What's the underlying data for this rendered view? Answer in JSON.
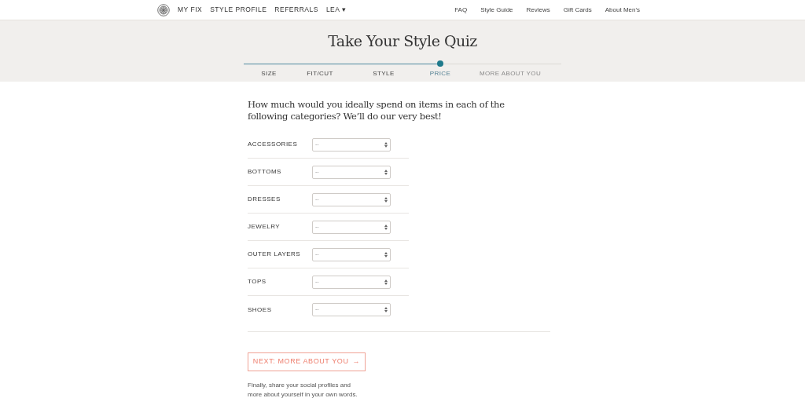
{
  "nav": {
    "left": [
      "MY FIX",
      "STYLE PROFILE",
      "REFERRALS"
    ],
    "user": "LEA",
    "user_caret": "▾",
    "right": [
      "FAQ",
      "Style Guide",
      "Reviews",
      "Gift Cards",
      "About Men's"
    ]
  },
  "title": "Take Your Style Quiz",
  "steps": [
    {
      "label": "SIZE",
      "selected": false
    },
    {
      "label": "FIT/CUT",
      "selected": false
    },
    {
      "label": "STYLE",
      "selected": false
    },
    {
      "label": "PRICE",
      "selected": true
    },
    {
      "label": "MORE ABOUT YOU",
      "selected": false
    }
  ],
  "question": "How much would you ideally spend on items in each of the following categories? We’ll do our very best!",
  "categories": [
    {
      "label": "ACCESSORIES",
      "value": "--"
    },
    {
      "label": "BOTTOMS",
      "value": "--"
    },
    {
      "label": "DRESSES",
      "value": "--"
    },
    {
      "label": "JEWELRY",
      "value": "--"
    },
    {
      "label": "OUTER LAYERS",
      "value": "--"
    },
    {
      "label": "TOPS",
      "value": "--"
    },
    {
      "label": "SHOES",
      "value": "--"
    }
  ],
  "next_button": {
    "label": "NEXT: MORE ABOUT YOU",
    "arrow": "→"
  },
  "footnote": "Finally, share your social profiles and more about yourself in your own words."
}
